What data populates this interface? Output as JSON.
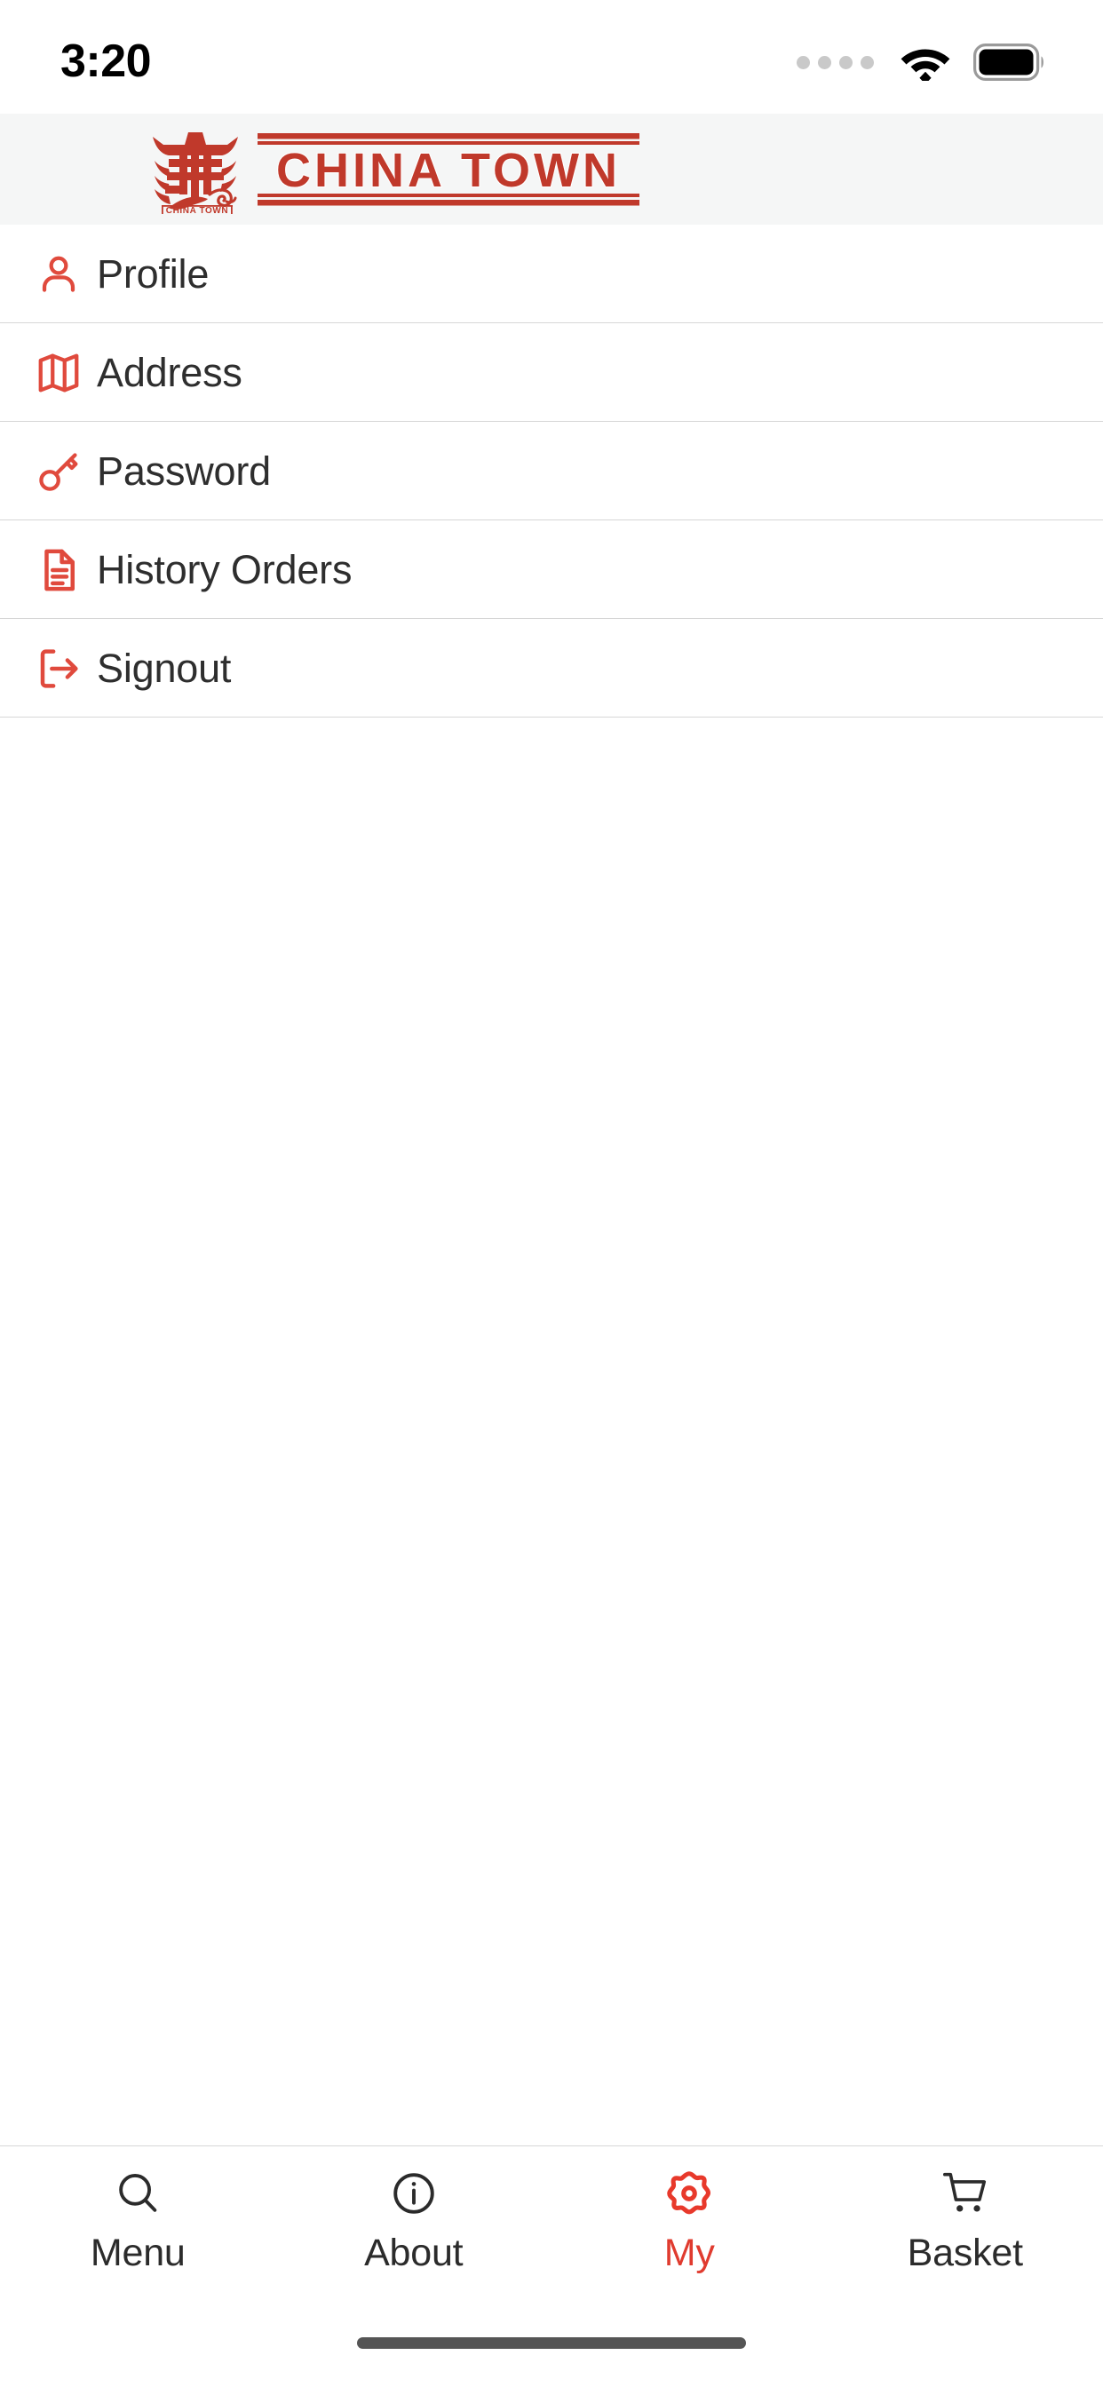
{
  "status_bar": {
    "time": "3:20",
    "signal_icon": "signal-dots-icon",
    "wifi_icon": "wifi-icon",
    "battery_icon": "battery-full-icon"
  },
  "header": {
    "logo_name": "china-town-logo",
    "logo_mark_caption": "CHINA TOWN",
    "banner_text": "CHINA TOWN",
    "background_color": "#f5f6f6",
    "brand_color": "#c0392b"
  },
  "theme": {
    "accent": "#e03b2f",
    "icon_red": "#e04a3d",
    "text_dark": "#2e2e2e",
    "divider": "#d6d6d6"
  },
  "menu": {
    "items": [
      {
        "label": "Profile",
        "icon": "user-icon"
      },
      {
        "label": "Address",
        "icon": "map-icon"
      },
      {
        "label": "Password",
        "icon": "key-icon"
      },
      {
        "label": "History Orders",
        "icon": "document-icon"
      },
      {
        "label": "Signout",
        "icon": "logout-icon"
      }
    ]
  },
  "tabbar": {
    "tabs": [
      {
        "label": "Menu",
        "icon": "search-icon",
        "active": false
      },
      {
        "label": "About",
        "icon": "info-circle-icon",
        "active": false
      },
      {
        "label": "My",
        "icon": "gear-icon",
        "active": true
      },
      {
        "label": "Basket",
        "icon": "shopping-cart-icon",
        "active": false
      }
    ]
  },
  "home_indicator": {
    "name": "home-indicator"
  }
}
